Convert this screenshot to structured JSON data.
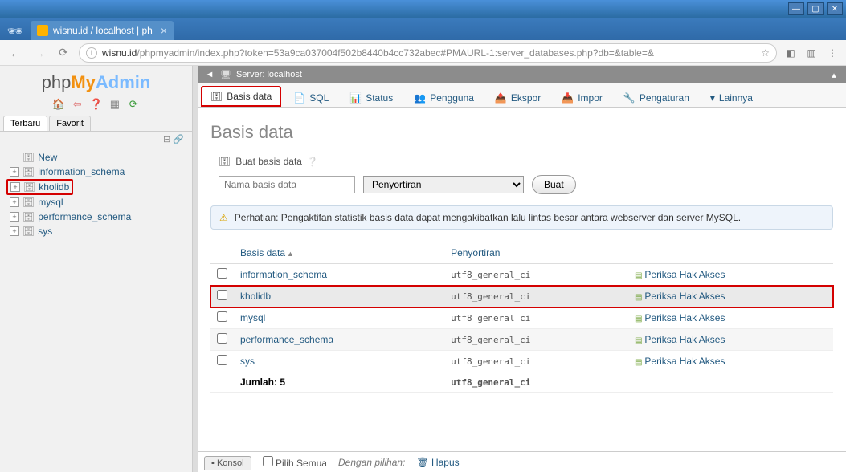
{
  "browser": {
    "tab_title": "wisnu.id / localhost | ph",
    "url_host": "wisnu.id",
    "url_path": "/phpmyadmin/index.php?token=53a9ca037004f502b8440b4cc732abec#PMAURL-1:server_databases.php?db=&table=&"
  },
  "logo": {
    "php": "php",
    "my": "My",
    "admin": "Admin"
  },
  "side_tabs": {
    "recent": "Terbaru",
    "favorite": "Favorit"
  },
  "tree": {
    "new": "New",
    "items": [
      "information_schema",
      "kholidb",
      "mysql",
      "performance_schema",
      "sys"
    ]
  },
  "server_bar": {
    "label": "Server: localhost"
  },
  "nav": {
    "database": "Basis data",
    "sql": "SQL",
    "status": "Status",
    "users": "Pengguna",
    "export": "Ekspor",
    "import": "Impor",
    "settings": "Pengaturan",
    "more": "Lainnya"
  },
  "page": {
    "title": "Basis data",
    "create_label": "Buat basis data",
    "name_placeholder": "Nama basis data",
    "sort_placeholder": "Penyortiran",
    "create_btn": "Buat",
    "notice": "Perhatian: Pengaktifan statistik basis data dapat mengakibatkan lalu lintas besar antara webserver dan server MySQL."
  },
  "table": {
    "col_db": "Basis data",
    "col_sort": "Penyortiran",
    "privs": "Periksa Hak Akses",
    "rows": [
      {
        "name": "information_schema",
        "coll": "utf8_general_ci",
        "hl": false
      },
      {
        "name": "kholidb",
        "coll": "utf8_general_ci",
        "hl": true
      },
      {
        "name": "mysql",
        "coll": "utf8_general_ci",
        "hl": false
      },
      {
        "name": "performance_schema",
        "coll": "utf8_general_ci",
        "hl": false
      },
      {
        "name": "sys",
        "coll": "utf8_general_ci",
        "hl": false
      }
    ],
    "total_label": "Jumlah: 5",
    "total_coll": "utf8_general_ci"
  },
  "bottom": {
    "console": "Konsol",
    "select_all": "Pilih Semua",
    "with_selected": "Dengan pilihan:",
    "delete": "Hapus"
  }
}
